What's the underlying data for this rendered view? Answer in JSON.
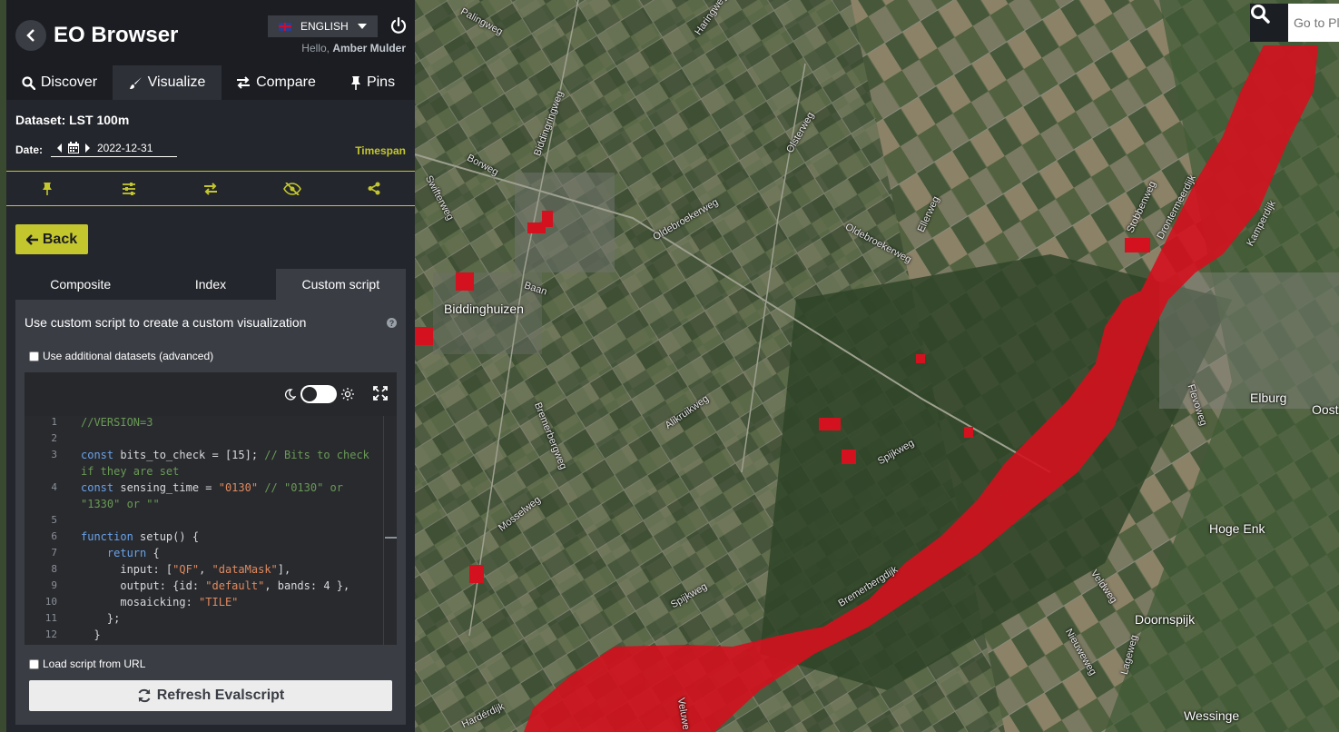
{
  "app": {
    "title": "EO Browser"
  },
  "header": {
    "language": "ENGLISH",
    "greeting": "Hello,",
    "user_name": "Amber Mulder"
  },
  "tabs": [
    {
      "label": "Discover",
      "icon": "search-icon"
    },
    {
      "label": "Visualize",
      "icon": "paintbrush-icon",
      "active": true
    },
    {
      "label": "Compare",
      "icon": "exchange-icon"
    },
    {
      "label": "Pins",
      "icon": "pin-icon"
    }
  ],
  "dataset": {
    "label": "Dataset: LST 100m"
  },
  "date": {
    "label": "Date:",
    "value": "2022-12-31",
    "timespan_label": "Timespan"
  },
  "toolbar": {
    "icons": [
      "pin-icon",
      "sliders-icon",
      "compare-icon",
      "hide-icon",
      "share-icon"
    ],
    "accent_color": "#c4c62e"
  },
  "back_button": {
    "label": "Back"
  },
  "visualization_tabs": [
    {
      "label": "Composite"
    },
    {
      "label": "Index"
    },
    {
      "label": "Custom script",
      "active": true
    }
  ],
  "custom_script": {
    "description": "Use custom script to create a custom visualization",
    "help": "?",
    "additional_datasets_label": "Use additional datasets (advanced)",
    "load_from_url_label": "Load script from URL",
    "refresh_label": "Refresh Evalscript"
  },
  "code_lines": [
    {
      "n": "1",
      "html": "<span class=\"cm\">//VERSION=3</span>"
    },
    {
      "n": "2",
      "html": ""
    },
    {
      "n": "3",
      "html": "<span class=\"kw\">const</span> bits_to_check = [15]; <span class=\"cm\">// Bits to check</span>"
    },
    {
      "n": "",
      "html": "<span class=\"cm\">if they are set</span>"
    },
    {
      "n": "4",
      "html": "<span class=\"kw\">const</span> sensing_time = <span class=\"str\">\"0130\"</span> <span class=\"cm\">// \"0130\" or</span>"
    },
    {
      "n": "",
      "html": "<span class=\"cm\">\"1330\" or \"\"</span>"
    },
    {
      "n": "5",
      "html": ""
    },
    {
      "n": "6",
      "html": "<span class=\"kw\">function</span> setup() {"
    },
    {
      "n": "7",
      "html": "    <span class=\"kw\">return</span> {"
    },
    {
      "n": "8",
      "html": "      input: [<span class=\"str\">\"QF\"</span>, <span class=\"str\">\"dataMask\"</span>],"
    },
    {
      "n": "9",
      "html": "      output: {id: <span class=\"str\">\"default\"</span>, bands: 4 },"
    },
    {
      "n": "10",
      "html": "      mosaicking: <span class=\"str\">\"TILE\"</span>"
    },
    {
      "n": "11",
      "html": "    };"
    },
    {
      "n": "12",
      "html": "  }"
    }
  ],
  "map": {
    "search_placeholder": "Go to Pla",
    "overlay_color": "#d4111e",
    "labels": [
      {
        "text": "Bremerbergdijk",
        "kind": "road"
      },
      {
        "text": "Biddinghuizen",
        "kind": "town"
      },
      {
        "text": "Elburg",
        "kind": "town"
      },
      {
        "text": "Hoge Enk",
        "kind": "town"
      },
      {
        "text": "Doornspijk",
        "kind": "town"
      },
      {
        "text": "Wessinge",
        "kind": "town"
      },
      {
        "text": "Oost",
        "kind": "town"
      },
      {
        "text": "Palingweg",
        "kind": "road"
      },
      {
        "text": "Haringweg",
        "kind": "road"
      },
      {
        "text": "Biddingringweg",
        "kind": "road"
      },
      {
        "text": "Borweg",
        "kind": "road"
      },
      {
        "text": "Swifterweg",
        "kind": "road"
      },
      {
        "text": "Olsterweg",
        "kind": "road"
      },
      {
        "text": "Oldebroekerweg",
        "kind": "road"
      },
      {
        "text": "Ellerweg",
        "kind": "road"
      },
      {
        "text": "Stobbenweg",
        "kind": "road"
      },
      {
        "text": "Drontermeerdijk",
        "kind": "road"
      },
      {
        "text": "Kamperdijk",
        "kind": "road"
      },
      {
        "text": "Baan",
        "kind": "road"
      },
      {
        "text": "Alikruikweg",
        "kind": "road"
      },
      {
        "text": "Spijkweg",
        "kind": "road"
      },
      {
        "text": "Mosselweg",
        "kind": "road"
      },
      {
        "text": "Bremerbergweg",
        "kind": "road"
      },
      {
        "text": "Flevoweg",
        "kind": "road"
      },
      {
        "text": "Veldweg",
        "kind": "road"
      },
      {
        "text": "Nieuweweg",
        "kind": "road"
      },
      {
        "text": "Lageweg",
        "kind": "road"
      },
      {
        "text": "Hardérdijk",
        "kind": "road"
      },
      {
        "text": "Veluwe",
        "kind": "road"
      }
    ]
  }
}
